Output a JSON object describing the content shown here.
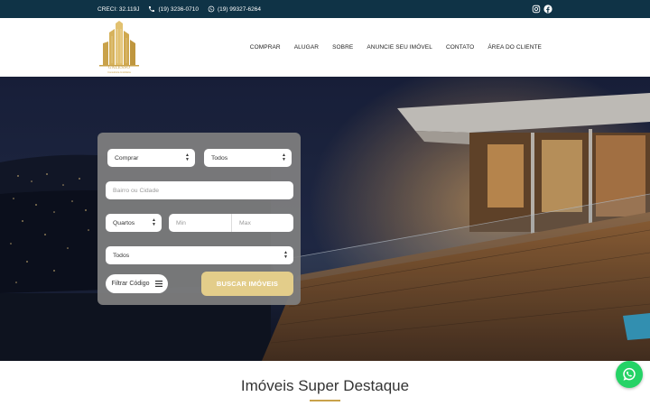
{
  "topbar": {
    "creci": "CRECI: 32.119J",
    "phone": "(19) 3236-0710",
    "whatsapp": "(19) 99327-6264",
    "social": [
      "instagram-icon",
      "facebook-icon"
    ]
  },
  "logo": {
    "name": "GALESSO",
    "tagline": "Consultoria Imobiliária"
  },
  "nav": {
    "items": [
      "COMPRAR",
      "ALUGAR",
      "SOBRE",
      "ANUNCIE SEU IMÓVEL",
      "CONTATO",
      "ÁREA DO CLIENTE"
    ]
  },
  "search": {
    "operation": "Comprar",
    "type": "Todos",
    "location_placeholder": "Bairro ou Cidade",
    "bedrooms": "Quartos",
    "min_placeholder": "Min",
    "max_placeholder": "Max",
    "category": "Todos",
    "code_filter_label": "Filtrar Código",
    "search_button": "BUSCAR IMÓVEIS"
  },
  "featured": {
    "title": "Imóveis Super Destaque"
  },
  "colors": {
    "topbar": "#0f3346",
    "gold": "#c9a24a",
    "search_button": "#e3cd8a",
    "whatsapp": "#25d366"
  }
}
